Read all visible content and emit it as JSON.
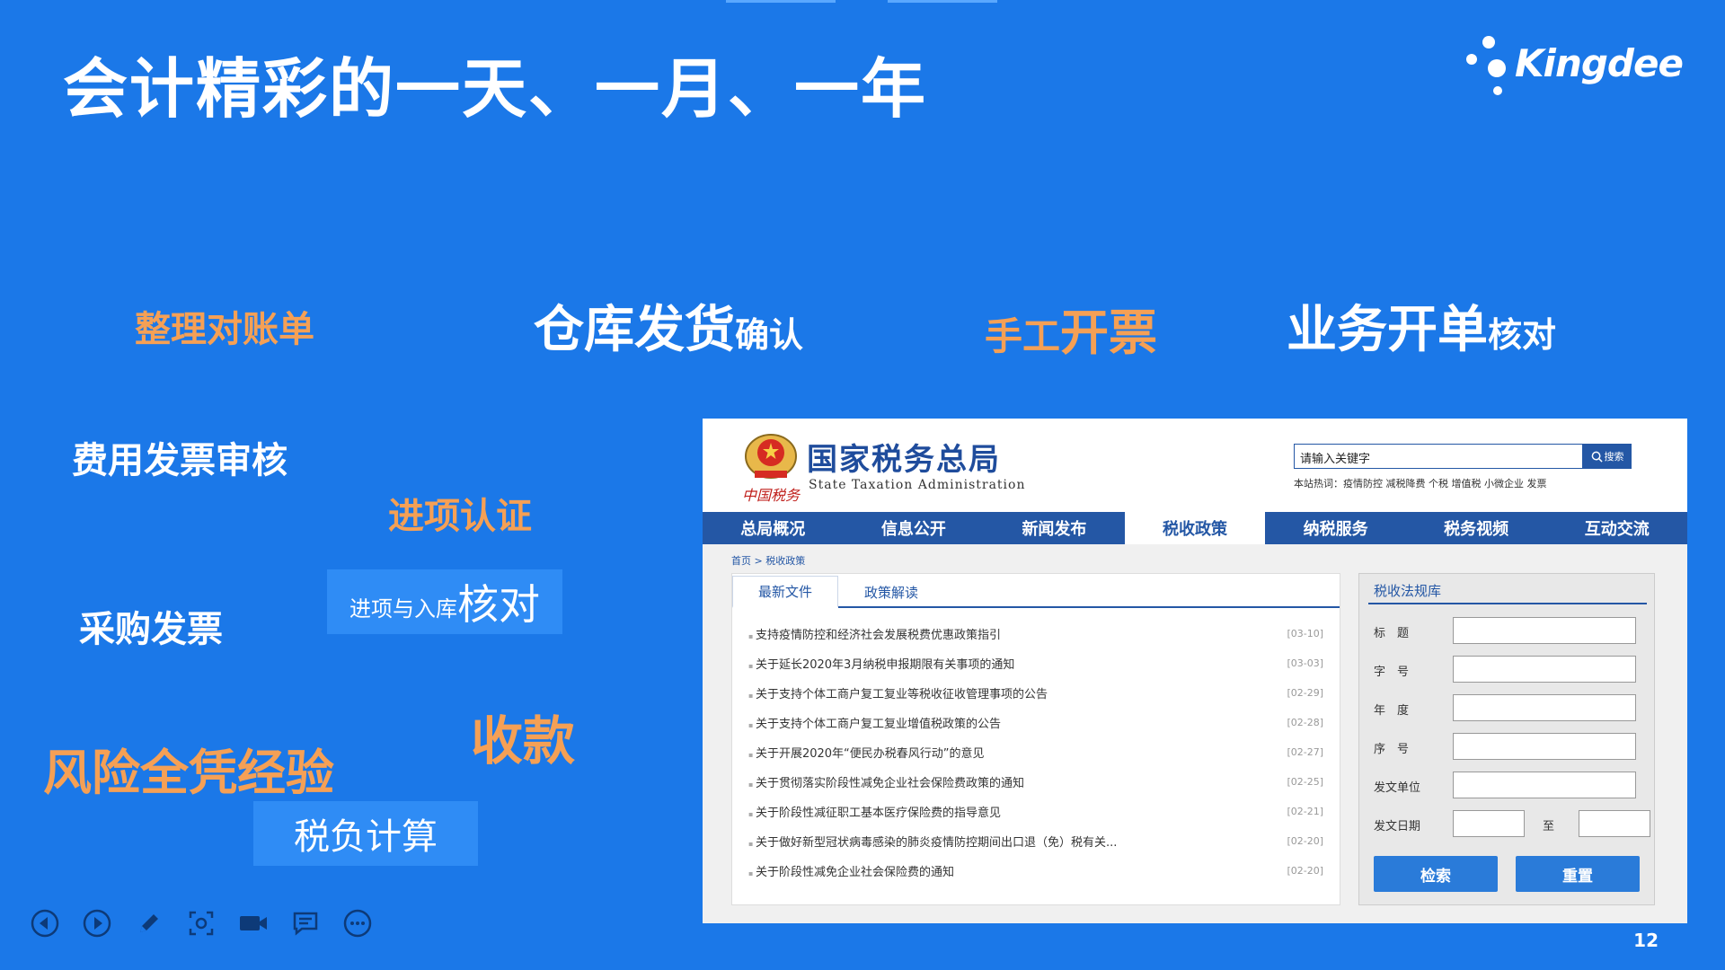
{
  "slide": {
    "title": "会计精彩的一天、一月、一年",
    "brand": "Kingdee",
    "page_number": "12"
  },
  "words": {
    "w1": "整理对账单",
    "w2_main": "仓库发货",
    "w2_suffix": "确认",
    "w3_a": "手工",
    "w3_b": "开票",
    "w4_main": "业务开单",
    "w4_suffix": "核对",
    "w5": "费用发票审核",
    "w6": "进项认证",
    "w7": "采购发票",
    "w8_small": "进项与入库",
    "w8_big": "核对",
    "w9": "收款",
    "w10": "风险全凭经验",
    "w11": "税负计算"
  },
  "site": {
    "org_cn": "国家税务总局",
    "org_en": "State Taxation Administration",
    "seal_sig": "中国税务",
    "search_placeholder": "请输入关键字",
    "search_button": "搜索",
    "hotwords": "本站热词：疫情防控  减税降费  个税  增值税  小微企业  发票",
    "nav": [
      "总局概况",
      "信息公开",
      "新闻发布",
      "税收政策",
      "纳税服务",
      "税务视频",
      "互动交流"
    ],
    "nav_active": 3,
    "breadcrumb": "首页 > 税收政策",
    "tabs": [
      "最新文件",
      "政策解读"
    ],
    "news": [
      {
        "title": "支持疫情防控和经济社会发展税费优惠政策指引",
        "date": "[03-10]"
      },
      {
        "title": "关于延长2020年3月纳税申报期限有关事项的通知",
        "date": "[03-03]"
      },
      {
        "title": "关于支持个体工商户复工复业等税收征收管理事项的公告",
        "date": "[02-29]"
      },
      {
        "title": "关于支持个体工商户复工复业增值税政策的公告",
        "date": "[02-28]"
      },
      {
        "title": "关于开展2020年“便民办税春风行动”的意见",
        "date": "[02-27]"
      },
      {
        "title": "关于贯彻落实阶段性减免企业社会保险费政策的通知",
        "date": "[02-25]"
      },
      {
        "title": "关于阶段性减征职工基本医疗保险费的指导意见",
        "date": "[02-21]"
      },
      {
        "title": "关于做好新型冠状病毒感染的肺炎疫情防控期间出口退（免）税有关...",
        "date": "[02-20]"
      },
      {
        "title": "关于阶段性减免企业社会保险费的通知",
        "date": "[02-20]"
      }
    ],
    "law_db": {
      "title": "税收法规库",
      "fields": [
        "标　题",
        "字　号",
        "年　度",
        "序　号",
        "发文单位",
        "发文日期"
      ],
      "to_label": "至",
      "search_btn": "检索",
      "reset_btn": "重置"
    }
  },
  "toolbar_icons": [
    "prev-icon",
    "next-icon",
    "pen-icon",
    "screen-capture-icon",
    "camera-icon",
    "comment-icon",
    "more-icon"
  ],
  "colors": {
    "background": "#1b78e8",
    "accent_orange": "#f5a055",
    "site_blue": "#2457a5"
  }
}
